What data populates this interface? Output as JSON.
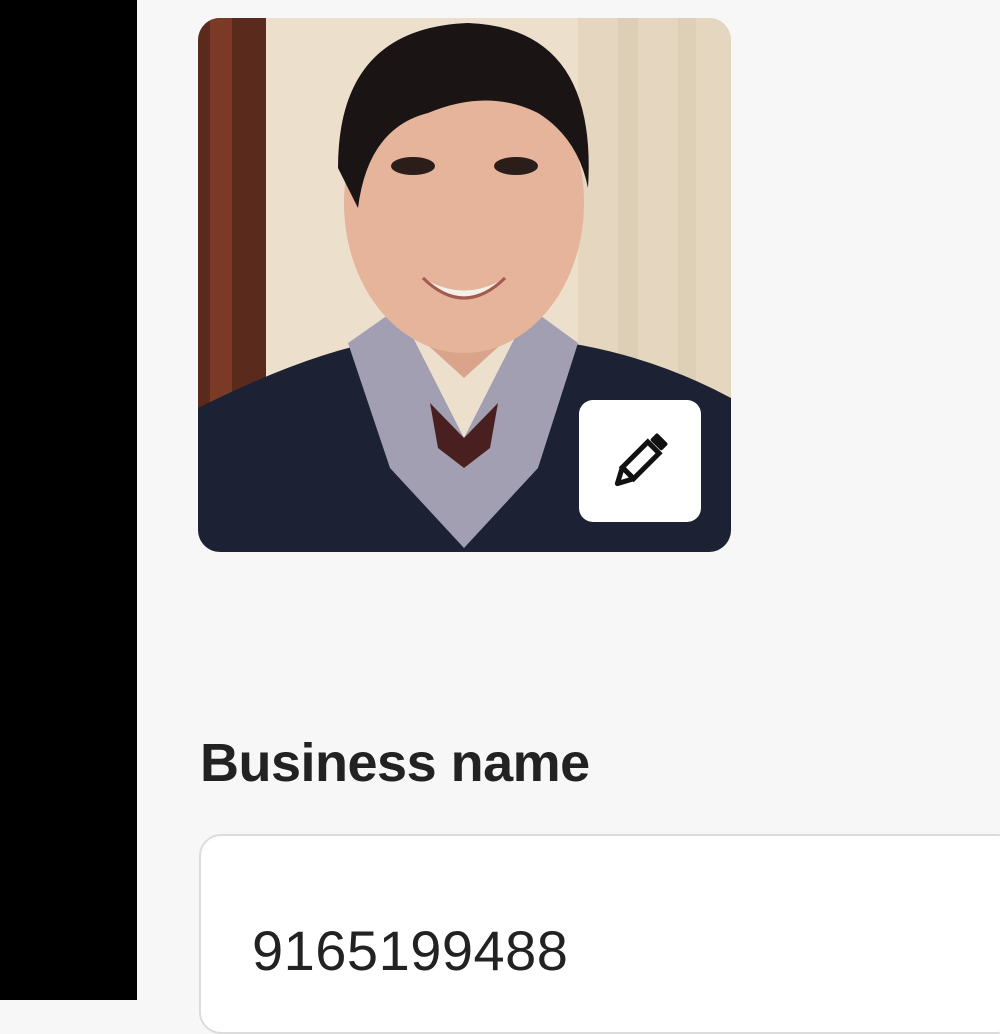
{
  "profile": {
    "photo_alt": "Profile photo",
    "edit_icon": "pencil-icon"
  },
  "form": {
    "business_name_label": "Business name",
    "business_name_value": "9165199488"
  },
  "colors": {
    "sidebar": "#000000",
    "background": "#f7f7f7",
    "text": "#222222",
    "input_border": "#dcdcdc"
  }
}
